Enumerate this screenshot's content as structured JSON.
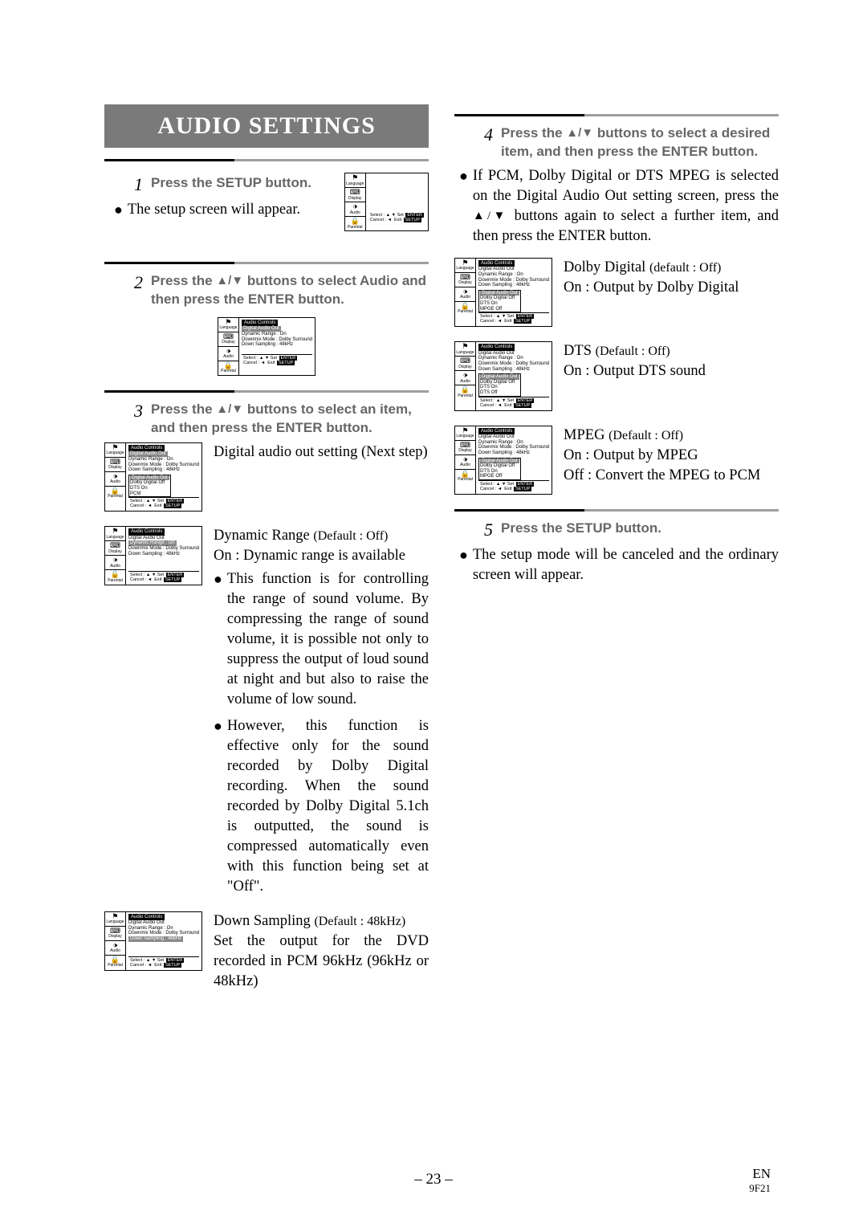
{
  "title": "AUDIO SETTINGS",
  "steps": {
    "s1_num": "1",
    "s1_instr": "Press the SETUP button.",
    "s1_body": "The setup screen will appear.",
    "s2_num": "2",
    "s2_instr_a": "Press the ",
    "s2_instr_b": " buttons to select Audio and then press the ENTER button.",
    "s3_num": "3",
    "s3_instr_a": "Press the ",
    "s3_instr_b": " buttons to select an item, and then press the ENTER button.",
    "s3_body_a": "Digital audio out setting (Next step)",
    "s3_dr_title": "Dynamic Range ",
    "s3_dr_def": "(Default : Off)",
    "s3_dr_on": "On : Dynamic range is available",
    "s3_dr_b1": "This function is for controlling the range of sound volume. By compressing the range of sound volume, it is possible not only to suppress the output of loud sound at night and but also to raise the volume of low sound.",
    "s3_dr_b2": "However, this function is effective only for the sound recorded by Dolby Digital recording. When the sound recorded by Dolby Digital 5.1ch is outputted, the sound is compressed automatically even with this function being set at \"Off\".",
    "s3_ds_title": "Down Sampling ",
    "s3_ds_def": "(Default : 48kHz)",
    "s3_ds_body": "Set the output for the DVD recorded in PCM 96kHz (96kHz or 48kHz)",
    "s4_num": "4",
    "s4_instr_a": "Press the ",
    "s4_instr_b": " buttons to select a desired item, and then press the ENTER button.",
    "s4_body_a": "If PCM, Dolby Digital or DTS MPEG is selected on the Digital Audio Out setting screen, press the ",
    "s4_body_b": " buttons again to select a further item, and then press the ENTER button.",
    "s4_dd_title": "Dolby Digital ",
    "s4_dd_def": "(default : Off)",
    "s4_dd_on": "On : Output by Dolby Digital",
    "s4_dts_title": "DTS ",
    "s4_dts_def": "(Default : Off)",
    "s4_dts_on": "On : Output DTS sound",
    "s4_mpeg_title": "MPEG ",
    "s4_mpeg_def": "(Default : Off)",
    "s4_mpeg_on": "On : Output by MPEG",
    "s4_mpeg_off": "Off : Convert the MPEG to PCM",
    "s5_num": "5",
    "s5_instr": "Press the SETUP button.",
    "s5_body": "The setup mode will be canceled and the ordinary screen will appear."
  },
  "glyphs": {
    "updown": "▲/▼"
  },
  "osd": {
    "side_lang": "Language",
    "side_display": "Display",
    "side_audio": "Audio",
    "side_parental": "Parental",
    "ico_flag": "⚑",
    "ico_tv": "⌨",
    "ico_speaker": "🕩",
    "ico_lock": "🔒",
    "hdr": "Audio Controls",
    "r1": "Digital Audio Out",
    "r2": "Dynamic Range : On",
    "r3": "Downmix Mode : Dolby Surround",
    "r4": "Down Sampling : 48kHz",
    "sub_hdr": "Digital Audio Out",
    "dd_off": "Dolby Digital Off",
    "dts_on": "DTS            On",
    "dts_off": "DTS            Off",
    "mpeg_off": "MPGE        Off",
    "pcm": "PCM",
    "foot_select": "Select :",
    "foot_set": "Set",
    "foot_enter": "ENTER",
    "foot_cancel": "Cancel :",
    "foot_exit": "Exit",
    "foot_setup": "SETUP",
    "arrow_ud": "▲ ▼",
    "arrow_l": "◄"
  },
  "footer": {
    "page": "– 23 –",
    "lang": "EN",
    "code": "9F21"
  }
}
